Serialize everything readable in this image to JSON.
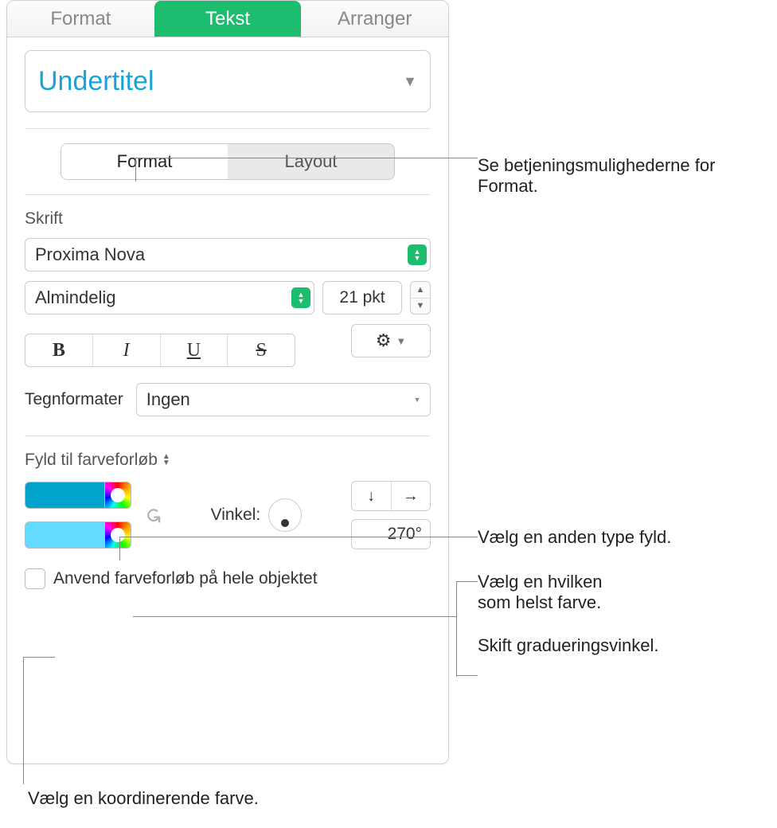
{
  "top_tabs": {
    "format": "Format",
    "tekst": "Tekst",
    "arranger": "Arranger"
  },
  "style_well": {
    "title": "Undertitel"
  },
  "subtabs": {
    "format": "Format",
    "layout": "Layout"
  },
  "font_section": {
    "label": "Skrift",
    "family": "Proxima Nova",
    "weight": "Almindelig",
    "size": "21 pkt"
  },
  "char_formats": {
    "label": "Tegnformater",
    "value": "Ingen"
  },
  "fill": {
    "label": "Fyld til farveforløb",
    "angle_label": "Vinkel:",
    "angle_value": "270°"
  },
  "apply_whole": "Anvend farveforløb på hele objektet",
  "callouts": {
    "c1": "Se betjeningsmulighederne for Format.",
    "c2": "Vælg en anden type fyld.",
    "c3a": "Vælg en hvilken",
    "c3b": "som helst farve.",
    "c4": "Skift gradueringsvinkel.",
    "c5": "Vælg en koordinerende farve."
  }
}
